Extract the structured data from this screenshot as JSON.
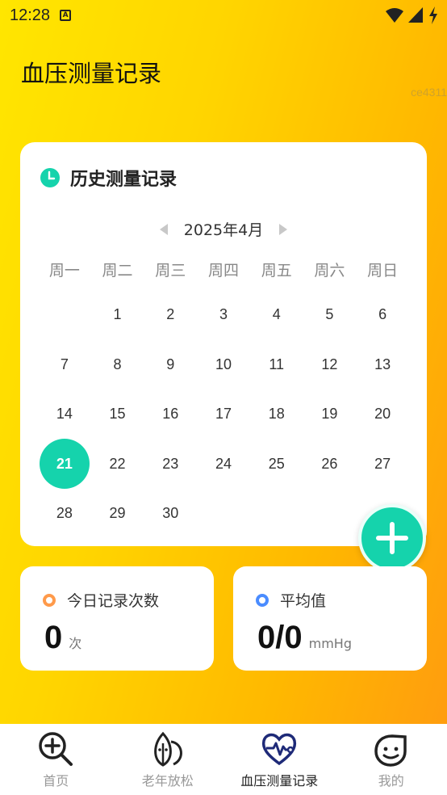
{
  "status": {
    "time": "12:28",
    "notif": "A"
  },
  "page": {
    "title": "血压测量记录",
    "watermark": "ce4311"
  },
  "calendar": {
    "title": "历史测量记录",
    "month": "2025年4月",
    "weekdays": [
      "周一",
      "周二",
      "周三",
      "周四",
      "周五",
      "周六",
      "周日"
    ],
    "leading_blanks": 1,
    "days": [
      "1",
      "2",
      "3",
      "4",
      "5",
      "6",
      "7",
      "8",
      "9",
      "10",
      "11",
      "12",
      "13",
      "14",
      "15",
      "16",
      "17",
      "18",
      "19",
      "20",
      "21",
      "22",
      "23",
      "24",
      "25",
      "26",
      "27",
      "28",
      "29",
      "30"
    ],
    "selected_day": "21"
  },
  "stats": {
    "today": {
      "label": "今日记录次数",
      "value": "0",
      "unit": "次"
    },
    "average": {
      "label": "平均值",
      "value": "0/0",
      "unit": "mmHg"
    }
  },
  "nav": [
    {
      "label": "首页",
      "icon": "search-plus-icon",
      "active": false
    },
    {
      "label": "老年放松",
      "icon": "leaf-icon",
      "active": false
    },
    {
      "label": "血压测量记录",
      "icon": "heart-pulse-icon",
      "active": true
    },
    {
      "label": "我的",
      "icon": "smile-icon",
      "active": false
    }
  ],
  "colors": {
    "accent": "#15d3ac",
    "orange": "#ff9a4a",
    "blue": "#4a8cff",
    "navy": "#1e2a78"
  }
}
